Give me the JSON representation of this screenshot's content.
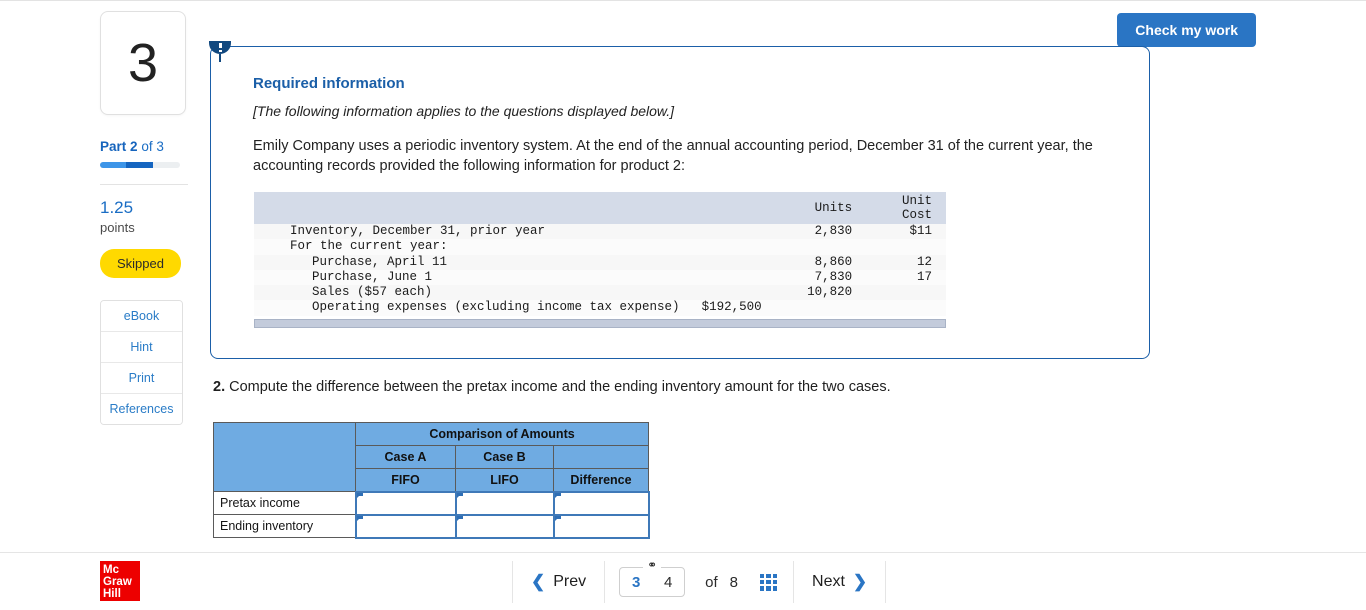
{
  "sidebar": {
    "question_number": "3",
    "part_prefix": "Part",
    "part_current": "2",
    "part_of": "of 3",
    "points_value": "1.25",
    "points_label": "points",
    "status_badge": "Skipped",
    "buttons": [
      {
        "label": "eBook"
      },
      {
        "label": "Hint"
      },
      {
        "label": "Print"
      },
      {
        "label": "References"
      }
    ]
  },
  "toolbar": {
    "check_my_work": "Check my work"
  },
  "question_card": {
    "required_title": "Required information",
    "italic_note": "[The following information applies to the questions displayed below.]",
    "body": "Emily Company uses a periodic inventory system. At the end of the annual accounting period, December 31 of the current year, the accounting records provided the following information for product 2:"
  },
  "data_table": {
    "headers": {
      "blank": "",
      "units": "Units",
      "unit_cost": "Unit\nCost"
    },
    "rows": [
      {
        "label": "Inventory, December 31, prior year",
        "indent": 1,
        "amount": "",
        "units": "2,830",
        "cost": "$11"
      },
      {
        "label": "For the current year:",
        "indent": 1,
        "amount": "",
        "units": "",
        "cost": ""
      },
      {
        "label": "Purchase, April 11",
        "indent": 2,
        "amount": "",
        "units": "8,860",
        "cost": "12"
      },
      {
        "label": "Purchase, June 1",
        "indent": 2,
        "amount": "",
        "units": "7,830",
        "cost": "17"
      },
      {
        "label": "Sales ($57 each)",
        "indent": 2,
        "amount": "",
        "units": "10,820",
        "cost": ""
      },
      {
        "label": "Operating expenses (excluding income tax expense)",
        "indent": 2,
        "amount": "$192,500",
        "units": "",
        "cost": ""
      }
    ]
  },
  "question_2": {
    "number": "2.",
    "text": "Compute the difference between the pretax income and the ending inventory amount for the two cases."
  },
  "answer_table": {
    "group_header": "Comparison of Amounts",
    "case_headers": [
      "Case A",
      "Case B",
      ""
    ],
    "method_headers": [
      "FIFO",
      "LIFO",
      "Difference"
    ],
    "rows": [
      {
        "label": "Pretax income",
        "values": [
          "",
          "",
          ""
        ]
      },
      {
        "label": "Ending inventory",
        "values": [
          "",
          "",
          ""
        ]
      }
    ]
  },
  "bottom_bar": {
    "logo_line1": "Mc",
    "logo_line2": "Graw",
    "logo_line3": "Hill",
    "prev_label": "Prev",
    "next_label": "Next",
    "page_current": "3",
    "page_linked": "4",
    "of_label": "of",
    "page_total": "8",
    "prev_icon": "chevron-left",
    "next_icon": "chevron-right",
    "link_icon": "⚭",
    "grid_icon": "grid-3x3"
  },
  "colors": {
    "accent_blue": "#2a75c4",
    "card_border": "#1b5fa8",
    "table_header_blue": "#6fabe2",
    "data_header_gray": "#d4dbe8",
    "badge_yellow": "#ffd900",
    "logo_red": "#ed0000"
  }
}
